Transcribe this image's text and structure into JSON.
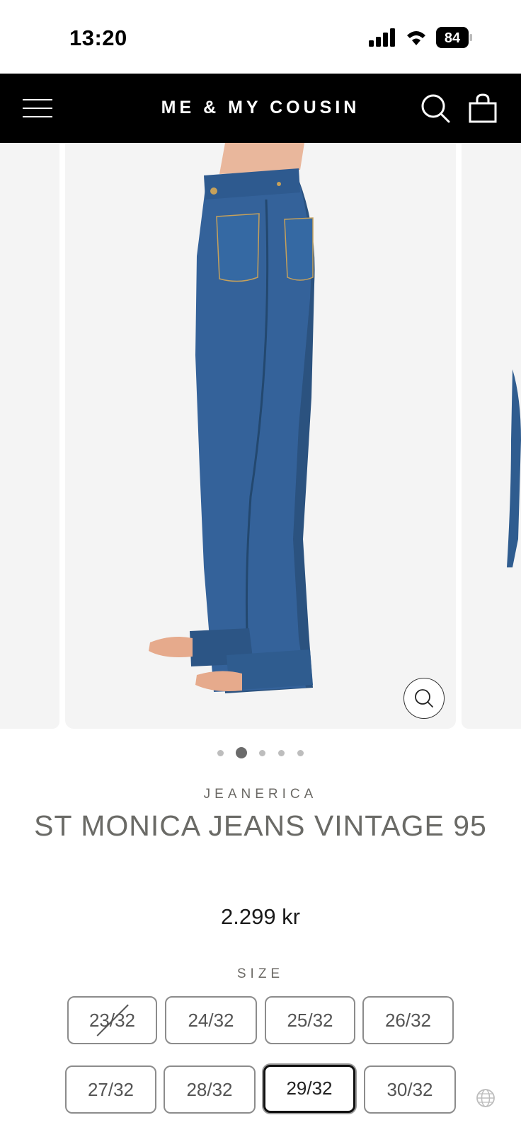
{
  "status_bar": {
    "time": "13:20",
    "battery_level": "84"
  },
  "header": {
    "brand": "ME & MY COUSIN",
    "menu_icon": "hamburger-icon",
    "search_icon": "search-icon",
    "cart_icon": "shopping-bag-icon"
  },
  "gallery": {
    "slide_count": 5,
    "active_index": 1,
    "zoom_icon": "zoom-icon"
  },
  "product": {
    "vendor": "JEANERICA",
    "title": "ST MONICA JEANS VINTAGE 95",
    "price": "2.299 kr",
    "size_label": "SIZE",
    "sizes": [
      {
        "label": "23/32",
        "available": false,
        "selected": false
      },
      {
        "label": "24/32",
        "available": true,
        "selected": false
      },
      {
        "label": "25/32",
        "available": true,
        "selected": false
      },
      {
        "label": "26/32",
        "available": true,
        "selected": false
      },
      {
        "label": "27/32",
        "available": true,
        "selected": false
      },
      {
        "label": "28/32",
        "available": true,
        "selected": false
      },
      {
        "label": "29/32",
        "available": true,
        "selected": true
      },
      {
        "label": "30/32",
        "available": true,
        "selected": false
      }
    ]
  },
  "colors": {
    "header_bg": "#000000",
    "denim": "#2f5a8c",
    "gallery_bg": "#f4f4f4",
    "muted_text": "#6a6a66"
  },
  "footer": {
    "language_icon": "globe-icon"
  }
}
